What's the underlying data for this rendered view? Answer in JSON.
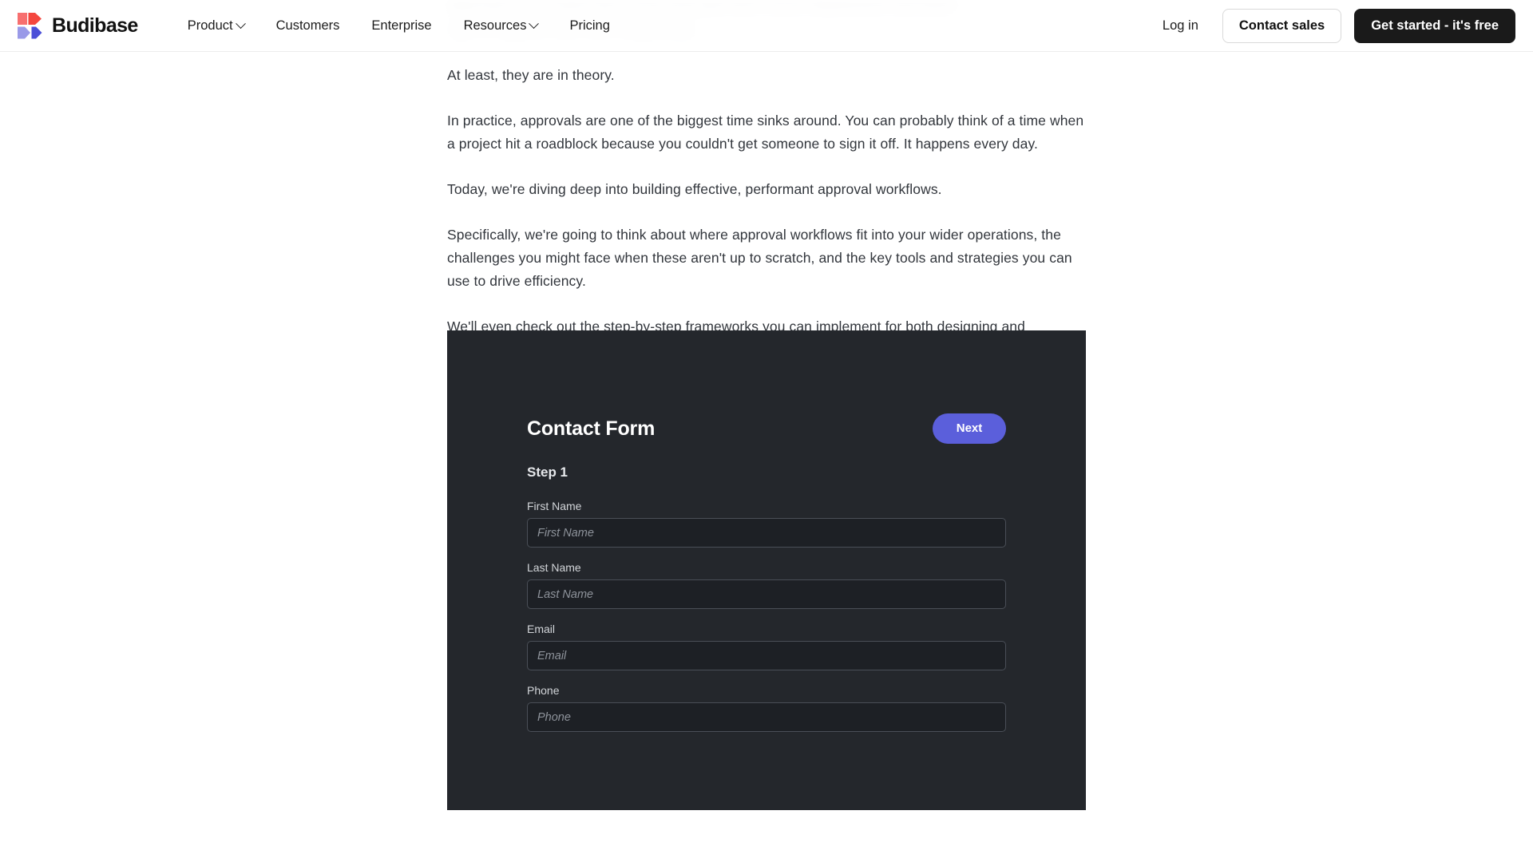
{
  "header": {
    "brand": {
      "name": "Budibase",
      "logo_colors": [
        "#f76f6f",
        "#f4473f",
        "#9a9ae8",
        "#4b4fd8"
      ]
    },
    "nav": [
      {
        "label": "Product",
        "has_chevron": true
      },
      {
        "label": "Customers",
        "has_chevron": false
      },
      {
        "label": "Enterprise",
        "has_chevron": false
      },
      {
        "label": "Resources",
        "has_chevron": true
      },
      {
        "label": "Pricing",
        "has_chevron": false
      }
    ],
    "login_label": "Log in",
    "contact_sales_label": "Contact sales",
    "get_started_label": "Get started - it's free"
  },
  "article": {
    "paragraphs": [
      "At least, they are in theory.",
      "In practice, approvals are one of the biggest time sinks around. You can probably think of a time when a project hit a roadblock because you couldn't get someone to sign it off. It happens every day.",
      "Today, we're diving deep into building effective, performant approval workflows.",
      "Specifically, we're going to think about where approval workflows fit into your wider operations, the challenges you might face when these aren't up to scratch, and the key tools and strategies you can use to drive efficiency.",
      "We'll even check out the step-by-step frameworks you can implement for both designing and implementing effective approvals."
    ],
    "obscured_line_1": "approvals are a routine part of how work gets done across departments and teams",
    "obscured_line_2": "sign off, approve and move things along"
  },
  "app_embed": {
    "title": "Contact Form",
    "next_label": "Next",
    "step_label": "Step 1",
    "accent_color": "#5b5fdb",
    "panel_color": "#24272c",
    "fields": [
      {
        "label": "First Name",
        "placeholder": "First Name",
        "value": ""
      },
      {
        "label": "Last Name",
        "placeholder": "Last Name",
        "value": ""
      },
      {
        "label": "Email",
        "placeholder": "Email",
        "value": ""
      },
      {
        "label": "Phone",
        "placeholder": "Phone",
        "value": ""
      }
    ]
  }
}
